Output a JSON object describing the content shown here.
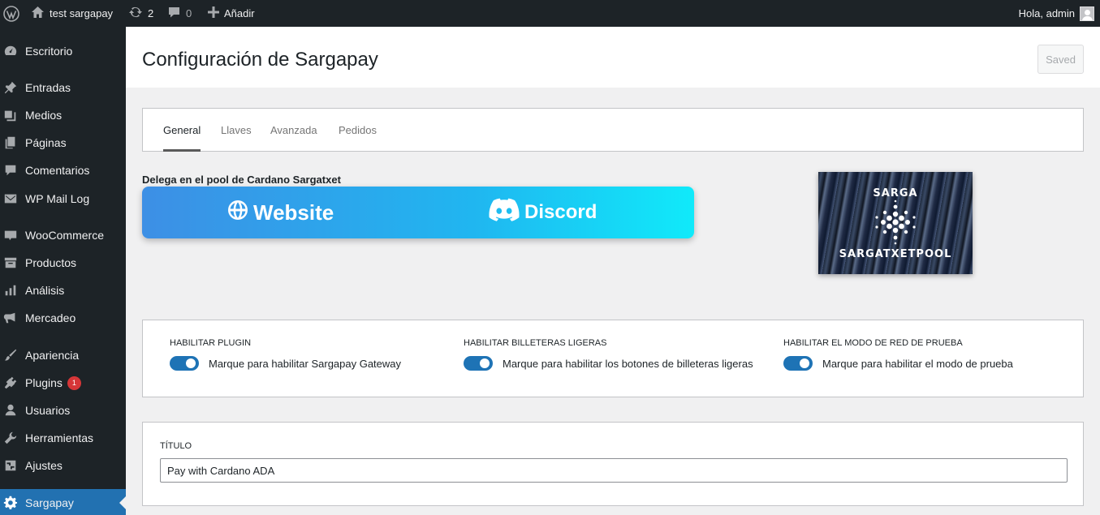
{
  "adminbar": {
    "site_name": "test sargapay",
    "updates_count": "2",
    "comments_count": "0",
    "new_label": "Añadir",
    "greeting": "Hola, admin"
  },
  "sidebar": {
    "items": [
      {
        "label": "Escritorio",
        "icon": "dashboard-icon"
      },
      {
        "label": "Entradas",
        "icon": "pin-icon"
      },
      {
        "label": "Medios",
        "icon": "media-icon"
      },
      {
        "label": "Páginas",
        "icon": "pages-icon"
      },
      {
        "label": "Comentarios",
        "icon": "comment-icon"
      },
      {
        "label": "WP Mail Log",
        "icon": "mail-icon"
      },
      {
        "label": "WooCommerce",
        "icon": "woocommerce-icon"
      },
      {
        "label": "Productos",
        "icon": "archive-icon"
      },
      {
        "label": "Análisis",
        "icon": "bar-chart-icon"
      },
      {
        "label": "Mercadeo",
        "icon": "megaphone-icon"
      },
      {
        "label": "Apariencia",
        "icon": "brush-icon"
      },
      {
        "label": "Plugins",
        "icon": "plugin-icon",
        "badge": "1"
      },
      {
        "label": "Usuarios",
        "icon": "users-icon"
      },
      {
        "label": "Herramientas",
        "icon": "wrench-icon"
      },
      {
        "label": "Ajustes",
        "icon": "settings-icon"
      },
      {
        "label": "Sargapay",
        "icon": "gear-icon",
        "current": true
      }
    ]
  },
  "header": {
    "title": "Configuración de Sargapay",
    "saved_label": "Saved"
  },
  "tabs": [
    {
      "label": "General",
      "active": true
    },
    {
      "label": "Llaves"
    },
    {
      "label": "Avanzada"
    },
    {
      "label": "Pedidos"
    }
  ],
  "promo": {
    "title": "Delega en el pool de Cardano Sargatxet",
    "website_label": "Website",
    "discord_label": "Discord",
    "logo_top": "SARGA",
    "logo_bottom": "SARGATXETPOOL"
  },
  "toggles": [
    {
      "heading": "HABILITAR PLUGIN",
      "text": "Marque para habilitar Sargapay Gateway",
      "enabled": true
    },
    {
      "heading": "HABILITAR BILLETERAS LIGERAS",
      "text": "Marque para habilitar los botones de billeteras ligeras",
      "enabled": true
    },
    {
      "heading": "HABILITAR EL MODO DE RED DE PRUEBA",
      "text": "Marque para habilitar el modo de prueba",
      "enabled": true
    }
  ],
  "title_field": {
    "label": "TÍTULO",
    "value": "Pay with Cardano ADA"
  },
  "colors": {
    "adminbar_bg": "#1d2327",
    "accent": "#2271b1",
    "toggle_on": "#1e73b5",
    "badge": "#d63638"
  }
}
